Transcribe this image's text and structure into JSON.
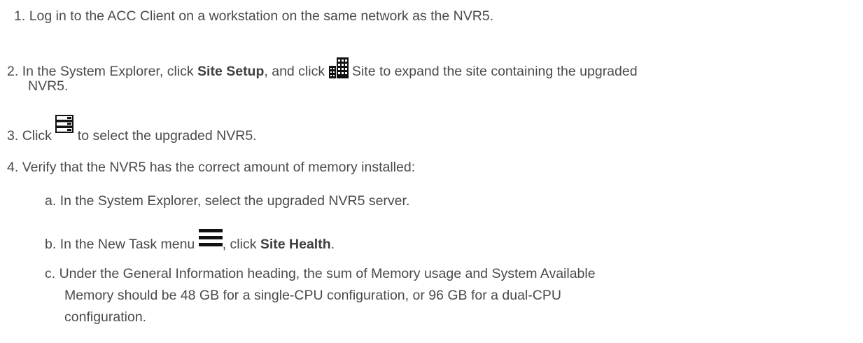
{
  "steps": [
    {
      "num": "1.",
      "text": "Log in to the ACC Client on a workstation on the same network as the NVR5."
    },
    {
      "num": "2.",
      "pre": "In the System Explorer, click ",
      "bold": "Site Setup",
      "mid": ", and click ",
      "icon": "building-icon",
      "post": " Site to expand the site containing the upgraded",
      "cont": "NVR5."
    },
    {
      "num": "3.",
      "pre": "Click ",
      "icon": "server-stack-icon",
      "post": " to select the upgraded NVR5."
    },
    {
      "num": "4.",
      "text": "Verify that the NVR5 has the correct amount of memory installed:"
    }
  ],
  "substeps": [
    {
      "letter": "a.",
      "text": "In the System Explorer, select the upgraded NVR5 server."
    },
    {
      "letter": "b.",
      "pre": "In the New Task menu ",
      "icon": "hamburger-menu-icon",
      "post": ", click ",
      "bold": "Site Health",
      "end": "."
    },
    {
      "letter": "c.",
      "lines": [
        "Under the General Information heading, the sum of Memory usage and System Available",
        "Memory should be 48 GB for a single-CPU configuration, or 96 GB for a dual-CPU",
        "configuration."
      ]
    }
  ]
}
